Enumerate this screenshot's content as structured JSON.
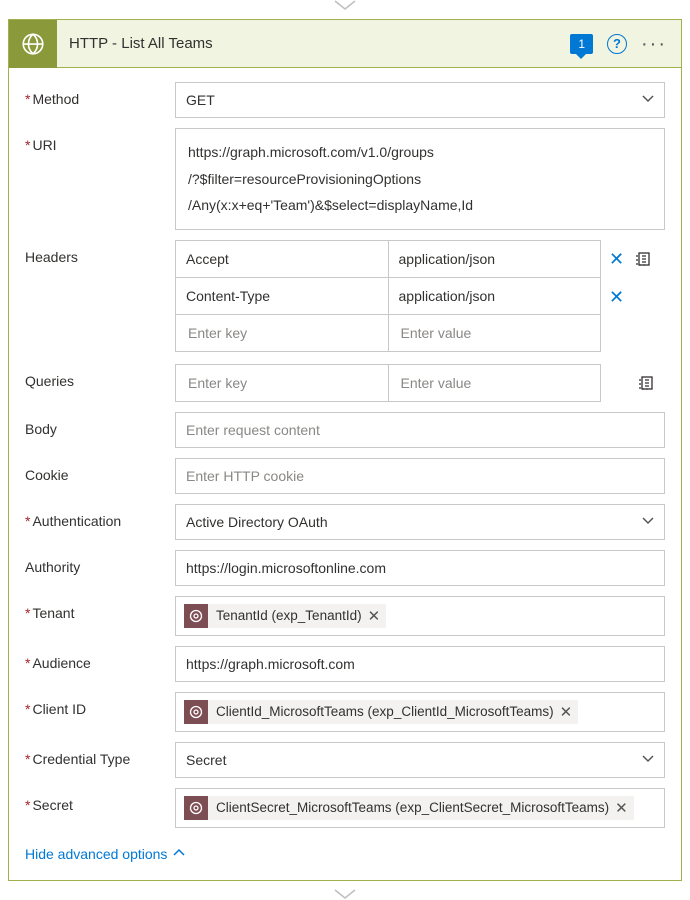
{
  "header": {
    "title": "HTTP - List All Teams",
    "comment_count": "1"
  },
  "fields": {
    "method": {
      "label": "Method",
      "value": "GET"
    },
    "uri": {
      "label": "URI",
      "line1": "https://graph.microsoft.com/v1.0/groups",
      "line2": "/?$filter=resourceProvisioningOptions",
      "line3": "/Any(x:x+eq+'Team')&$select=displayName,Id"
    },
    "headers": {
      "label": "Headers",
      "rows": [
        {
          "key": "Accept",
          "value": "application/json"
        },
        {
          "key": "Content-Type",
          "value": "application/json"
        }
      ],
      "key_placeholder": "Enter key",
      "value_placeholder": "Enter value"
    },
    "queries": {
      "label": "Queries",
      "key_placeholder": "Enter key",
      "value_placeholder": "Enter value"
    },
    "body": {
      "label": "Body",
      "placeholder": "Enter request content"
    },
    "cookie": {
      "label": "Cookie",
      "placeholder": "Enter HTTP cookie"
    },
    "authentication": {
      "label": "Authentication",
      "value": "Active Directory OAuth"
    },
    "authority": {
      "label": "Authority",
      "value": "https://login.microsoftonline.com"
    },
    "tenant": {
      "label": "Tenant",
      "token": "TenantId (exp_TenantId)"
    },
    "audience": {
      "label": "Audience",
      "value": "https://graph.microsoft.com"
    },
    "client_id": {
      "label": "Client ID",
      "token": "ClientId_MicrosoftTeams (exp_ClientId_MicrosoftTeams)"
    },
    "credential_type": {
      "label": "Credential Type",
      "value": "Secret"
    },
    "secret": {
      "label": "Secret",
      "token": "ClientSecret_MicrosoftTeams (exp_ClientSecret_MicrosoftTeams)"
    }
  },
  "footer": {
    "toggle": "Hide advanced options"
  }
}
